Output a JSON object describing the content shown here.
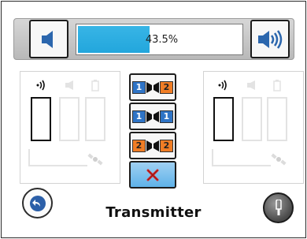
{
  "header": {
    "volume_down": {
      "icon": "speaker-low-icon"
    },
    "volume_up": {
      "icon": "speaker-high-icon"
    },
    "level": {
      "label": "43.5%",
      "value_percent": 43.5
    }
  },
  "left_panel": {
    "icons": [
      "wave-icon",
      "speaker-icon",
      "battery-icon",
      "satellite-icon"
    ]
  },
  "right_panel": {
    "icons": [
      "wave-icon",
      "speaker-icon",
      "battery-icon",
      "satellite-icon"
    ]
  },
  "modes": [
    {
      "left": "1",
      "right": "2"
    },
    {
      "left": "1",
      "right": "1"
    },
    {
      "left": "2",
      "right": "2"
    }
  ],
  "cancel": {
    "icon": "red-x-icon"
  },
  "footer": {
    "title": "Transmitter"
  },
  "colors": {
    "accent_blue": "#2f74c6",
    "accent_orange": "#f07d25",
    "level_fill": "#22a6dc"
  }
}
